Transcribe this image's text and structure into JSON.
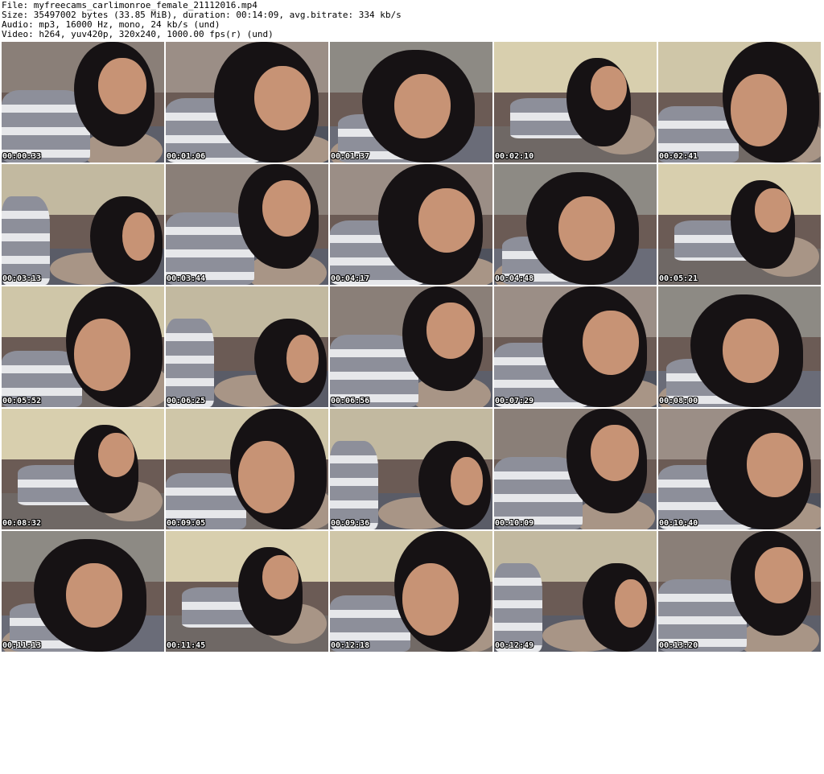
{
  "header": {
    "file_line": "File: myfreecams_carlimonroe_female_21112016.mp4",
    "size_line": "Size: 35497002 bytes (33.85 MiB), duration: 00:14:09, avg.bitrate: 334 kb/s",
    "audio_line": "Audio: mp3, 16000 Hz, mono, 24 kb/s (und)",
    "video_line": "Video: h264, yuv420p, 320x240, 1000.00 fps(r) (und)"
  },
  "thumbnails": [
    {
      "timestamp": "00:00:33"
    },
    {
      "timestamp": "00:01:06"
    },
    {
      "timestamp": "00:01:37"
    },
    {
      "timestamp": "00:02:10"
    },
    {
      "timestamp": "00:02:41"
    },
    {
      "timestamp": "00:03:13"
    },
    {
      "timestamp": "00:03:44"
    },
    {
      "timestamp": "00:04:17"
    },
    {
      "timestamp": "00:04:48"
    },
    {
      "timestamp": "00:05:21"
    },
    {
      "timestamp": "00:05:52"
    },
    {
      "timestamp": "00:06:25"
    },
    {
      "timestamp": "00:06:56"
    },
    {
      "timestamp": "00:07:29"
    },
    {
      "timestamp": "00:08:00"
    },
    {
      "timestamp": "00:08:32"
    },
    {
      "timestamp": "00:09:05"
    },
    {
      "timestamp": "00:09:36"
    },
    {
      "timestamp": "00:10:09"
    },
    {
      "timestamp": "00:10:40"
    },
    {
      "timestamp": "00:11:13"
    },
    {
      "timestamp": "00:11:45"
    },
    {
      "timestamp": "00:12:18"
    },
    {
      "timestamp": "00:12:49"
    },
    {
      "timestamp": "00:13:20"
    }
  ],
  "colors": {
    "background": "#ffffff",
    "timestamp_text": "#ffffff",
    "timestamp_outline": "#000000",
    "sweater_gray": "#8d8f9a",
    "sweater_stripe": "#e6e7ea",
    "hair": "#161214",
    "skin": "#c79375"
  }
}
